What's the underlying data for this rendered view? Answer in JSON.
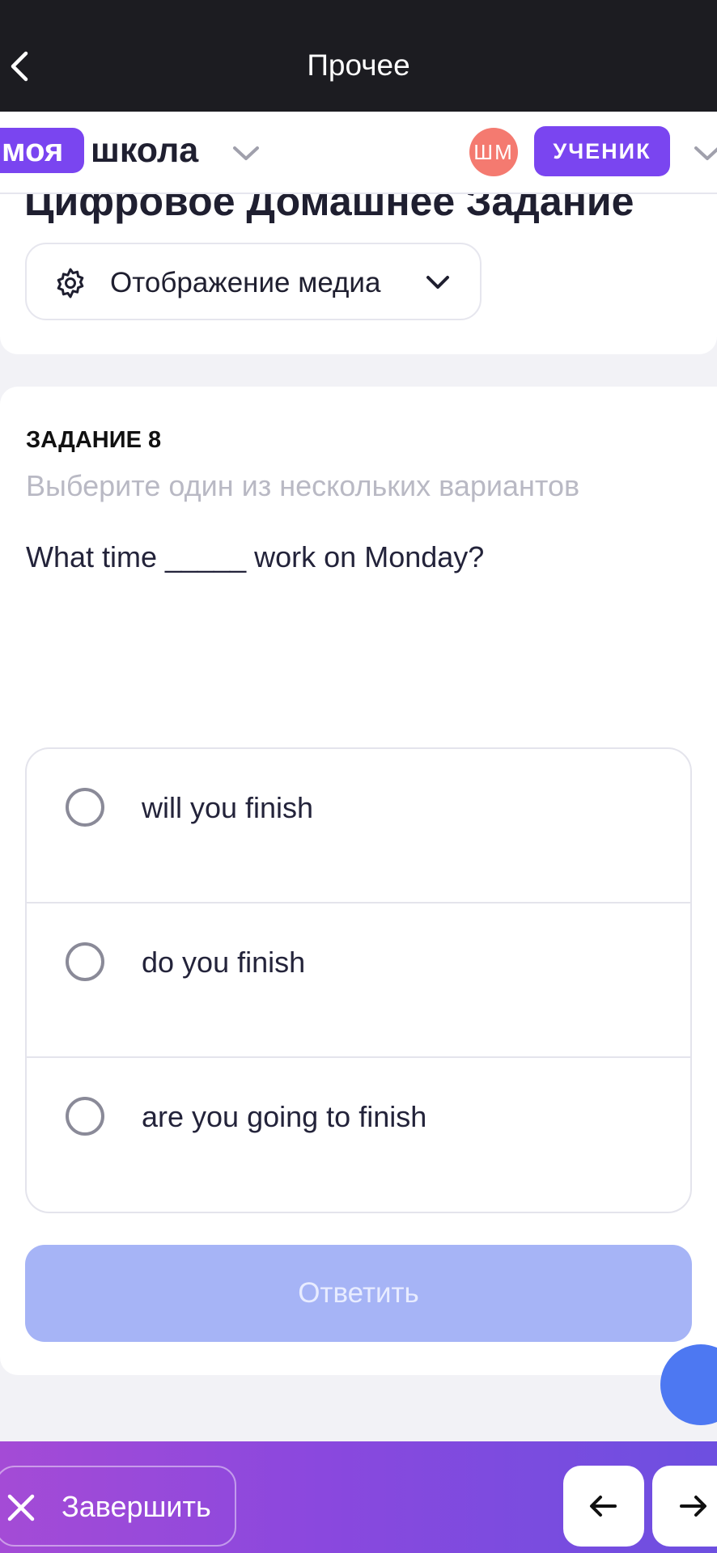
{
  "topbar": {
    "title": "Прочее"
  },
  "header": {
    "logo_badge": "моя",
    "logo_text": "школа",
    "avatar_initials": "ШМ",
    "role_label": "УЧЕНИК"
  },
  "page": {
    "title": "Цифровое Домашнее Задание",
    "media_button_label": "Отображение медиа"
  },
  "task": {
    "number_label": "ЗАДАНИЕ 8",
    "hint": "Выберите один из нескольких вариантов",
    "question": "What time _____ work on Monday?",
    "options": [
      {
        "label": "will you finish",
        "selected": false
      },
      {
        "label": "do you finish",
        "selected": false
      },
      {
        "label": "are you going to finish",
        "selected": false
      }
    ],
    "answer_button": "Ответить"
  },
  "help": {
    "label": "?"
  },
  "bottombar": {
    "finish_label": "Завершить"
  },
  "colors": {
    "brand_purple": "#7a45f0",
    "avatar_red": "#f47a70",
    "answer_disabled": "#a6b4f6",
    "help_blue": "#4d78f2"
  },
  "icons": {
    "back": "chevron-left-icon",
    "gear": "gear-icon",
    "close": "close-icon",
    "prev": "arrow-left-icon",
    "next": "arrow-right-icon"
  }
}
